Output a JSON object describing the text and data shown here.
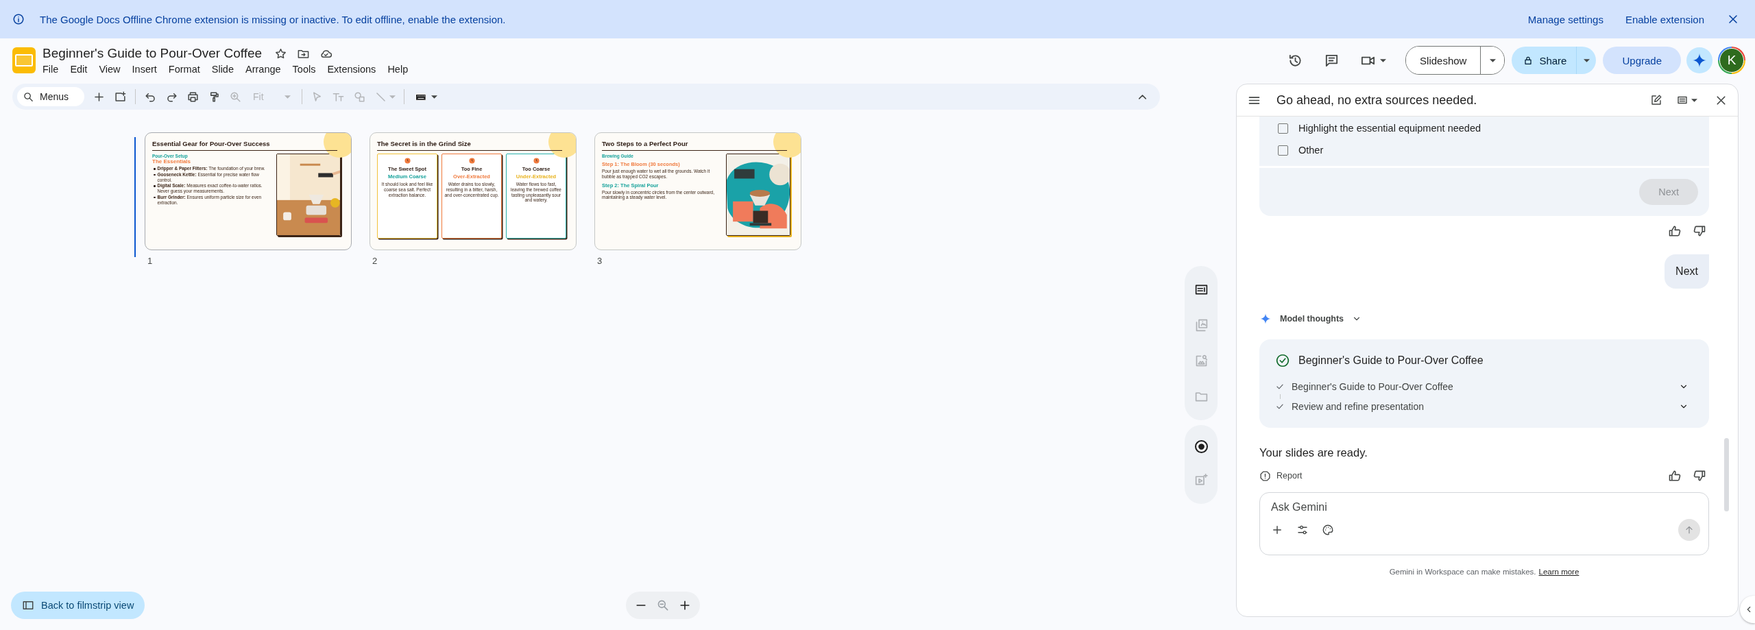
{
  "banner": {
    "message": "The Google Docs Offline Chrome extension is missing or inactive. To edit offline, enable the extension.",
    "actions": [
      "Manage settings",
      "Enable extension"
    ]
  },
  "document": {
    "title": "Beginner's Guide to Pour-Over Coffee"
  },
  "menu": [
    "File",
    "Edit",
    "View",
    "Insert",
    "Format",
    "Slide",
    "Arrange",
    "Tools",
    "Extensions",
    "Help"
  ],
  "header": {
    "slideshow": "Slideshow",
    "share": "Share",
    "upgrade": "Upgrade",
    "avatar": "K"
  },
  "toolbar": {
    "search": {
      "placeholder": "Menus"
    },
    "zoom_value": "Fit",
    "tools": [
      {
        "kind": "plus",
        "disabled": false
      },
      {
        "kind": "new-slide",
        "disabled": false
      },
      {
        "kind": "separator"
      },
      {
        "kind": "undo",
        "disabled": false
      },
      {
        "kind": "redo",
        "disabled": false
      },
      {
        "kind": "print",
        "disabled": false
      },
      {
        "kind": "paint-format",
        "disabled": false
      },
      {
        "kind": "zoom",
        "disabled": true
      },
      {
        "kind": "fit",
        "disabled": true
      },
      {
        "kind": "separator"
      },
      {
        "kind": "select",
        "disabled": true
      },
      {
        "kind": "text-box",
        "disabled": true
      },
      {
        "kind": "shape",
        "disabled": true
      },
      {
        "kind": "line",
        "disabled": true
      },
      {
        "kind": "separator"
      },
      {
        "kind": "keyboard",
        "disabled": false
      }
    ]
  },
  "slides": [
    {
      "number": "1",
      "selected": true,
      "kind": "list",
      "title": "Essential Gear for Pour-Over Success",
      "kicker": "Pour-Over Setup",
      "heading": "The Essentials",
      "bullets": [
        "**Dripper & Paper Filters:** The foundation of your brew.",
        "**Gooseneck Kettle:** Essential for precise water flow control.",
        "**Digital Scale:** Measures exact coffee-to-water ratios. Never guess your measurements.",
        "**Burr Grinder:** Ensures uniform particle size for even extraction."
      ]
    },
    {
      "number": "2",
      "selected": false,
      "kind": "cards",
      "title": "The Secret is in the Grind Size",
      "cards": [
        {
          "title": "The Sweet Spot",
          "subtitle": {
            "text": "Medium Coarse",
            "color": "#16a29b"
          },
          "text": "It should look and feel like coarse sea salt. Perfect extraction balance.",
          "color": "#f2c13a"
        },
        {
          "title": "Too Fine",
          "subtitle": {
            "text": "Over-Extracted",
            "color": "#f07b3f"
          },
          "text": "Water drains too slowly, resulting in a bitter, harsh, and over-concentrated cup.",
          "color": "#f07b3f"
        },
        {
          "title": "Too Coarse",
          "subtitle": {
            "text": "Under-Extracted",
            "color": "#e8b21c"
          },
          "text": "Water flows too fast, leaving the brewed coffee tasting unpleasantly sour and watery.",
          "color": "#2bb3ae"
        }
      ]
    },
    {
      "number": "3",
      "selected": false,
      "kind": "steps",
      "title": "Two Steps to a Perfect Pour",
      "kicker": "Brewing Guide",
      "steps": [
        {
          "heading": "Step 1: The Bloom (30 seconds)",
          "text": "Pour just enough water to wet all the grounds. Watch it bubble as trapped CO2 escapes.",
          "color": "#f07b3f"
        },
        {
          "heading": "Step 2: The Spiral Pour",
          "text": "Pour slowly in concentric circles from the center outward, maintaining a steady water level.",
          "color": "#16a29b"
        }
      ]
    }
  ],
  "rail_groups": [
    {
      "items": [
        {
          "kind": "slide-text",
          "disabled": false
        },
        {
          "kind": "gallery",
          "disabled": true
        },
        {
          "kind": "image-search",
          "disabled": true
        },
        {
          "kind": "folder",
          "disabled": true
        }
      ]
    },
    {
      "items": [
        {
          "kind": "record",
          "disabled": false
        },
        {
          "kind": "video-spark",
          "disabled": true
        }
      ]
    }
  ],
  "gemini": {
    "title": "Go ahead, no extra sources needed.",
    "options": [
      {
        "label": "Highlight the essential equipment needed",
        "checked": false
      },
      {
        "label": "Other",
        "checked": false
      }
    ],
    "next_button": {
      "label": "Next",
      "disabled": true
    },
    "user_message": "Next",
    "thoughts_label": "Model thoughts",
    "task": {
      "title": "Beginner's Guide to Pour-Over Coffee",
      "done": true,
      "steps": [
        {
          "label": "Beginner's Guide to Pour-Over Coffee",
          "done": true
        },
        {
          "label": "Review and refine presentation",
          "done": true
        }
      ]
    },
    "reply": "Your slides are ready.",
    "report": "Report",
    "input": {
      "placeholder": "Ask Gemini"
    },
    "disclaimer": "Gemini in Workspace can make mistakes.",
    "learn_more": "Learn more"
  },
  "bottom": {
    "filmstrip_button": "Back to filmstrip view"
  }
}
